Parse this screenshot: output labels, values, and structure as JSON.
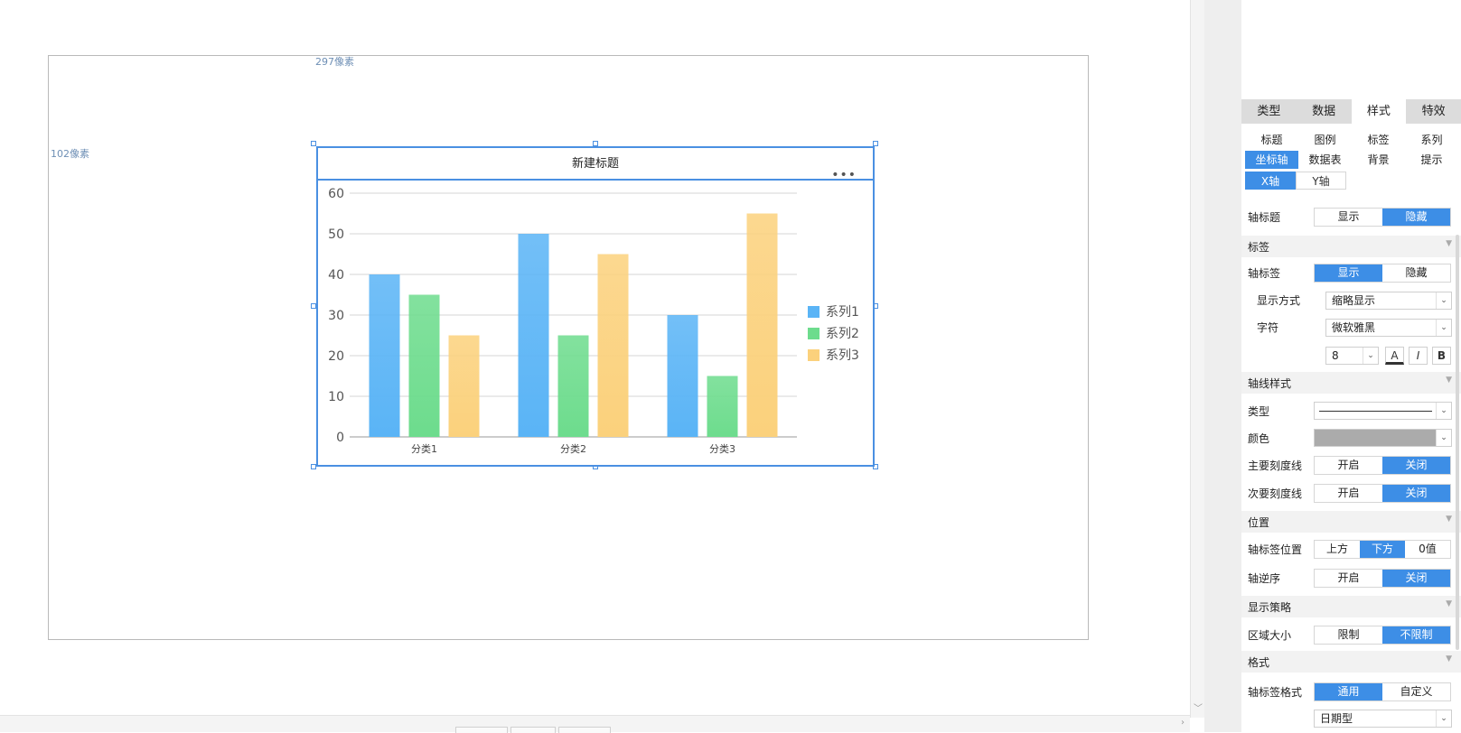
{
  "canvas": {
    "width_note": "297像素",
    "height_note": "102像素"
  },
  "chart_data": {
    "type": "bar",
    "title": "新建标题",
    "categories": [
      "分类1",
      "分类2",
      "分类3"
    ],
    "series": [
      {
        "name": "系列1",
        "values": [
          40,
          50,
          30
        ],
        "color": "#5ab4f6"
      },
      {
        "name": "系列2",
        "values": [
          35,
          25,
          15
        ],
        "color": "#6ddc8d"
      },
      {
        "name": "系列3",
        "values": [
          25,
          45,
          55
        ],
        "color": "#fbd17c"
      }
    ],
    "ylim": [
      0,
      60
    ],
    "yticks": [
      0,
      10,
      20,
      30,
      40,
      50,
      60
    ],
    "grid": true,
    "legend": "right",
    "more_label": "•••"
  },
  "panel": {
    "main_tabs": [
      "类型",
      "数据",
      "样式",
      "特效"
    ],
    "active_main_tab": "样式",
    "sub_tabs": [
      "标题",
      "图例",
      "标签",
      "系列",
      "坐标轴",
      "数据表",
      "背景",
      "提示"
    ],
    "active_sub_tab": "坐标轴",
    "axis_tabs": [
      "X轴",
      "Y轴"
    ],
    "active_axis_tab": "X轴",
    "axis_title": {
      "label": "轴标题",
      "options": [
        "显示",
        "隐藏"
      ],
      "selected": "隐藏"
    },
    "section_labels": {
      "label": "标签",
      "line_style": "轴线样式",
      "position": "位置",
      "strategy": "显示策略",
      "format": "格式"
    },
    "axis_label": {
      "label": "轴标签",
      "options": [
        "显示",
        "隐藏"
      ],
      "selected": "显示"
    },
    "display_mode": {
      "label": "显示方式",
      "value": "缩略显示"
    },
    "font": {
      "label": "字符",
      "value": "微软雅黑",
      "size": "8",
      "color_btn": "A",
      "italic_btn": "I",
      "bold_btn": "B"
    },
    "line_type": {
      "label": "类型"
    },
    "line_color": {
      "label": "颜色",
      "value": "#ababab"
    },
    "major_tick": {
      "label": "主要刻度线",
      "options": [
        "开启",
        "关闭"
      ],
      "selected": "关闭"
    },
    "minor_tick": {
      "label": "次要刻度线",
      "options": [
        "开启",
        "关闭"
      ],
      "selected": "关闭"
    },
    "label_position": {
      "label": "轴标签位置",
      "options": [
        "上方",
        "下方",
        "0值"
      ],
      "selected": "下方"
    },
    "reverse": {
      "label": "轴逆序",
      "options": [
        "开启",
        "关闭"
      ],
      "selected": "关闭"
    },
    "area_size": {
      "label": "区域大小",
      "options": [
        "限制",
        "不限制"
      ],
      "selected": "不限制"
    },
    "label_format": {
      "label": "轴标签格式",
      "options": [
        "通用",
        "自定义"
      ],
      "selected": "通用"
    },
    "date_type": {
      "value": "日期型"
    }
  },
  "icons": {
    "caret": "▼",
    "dropdown": "⌄",
    "scroll_down": "﹀",
    "scroll_right": "›"
  }
}
